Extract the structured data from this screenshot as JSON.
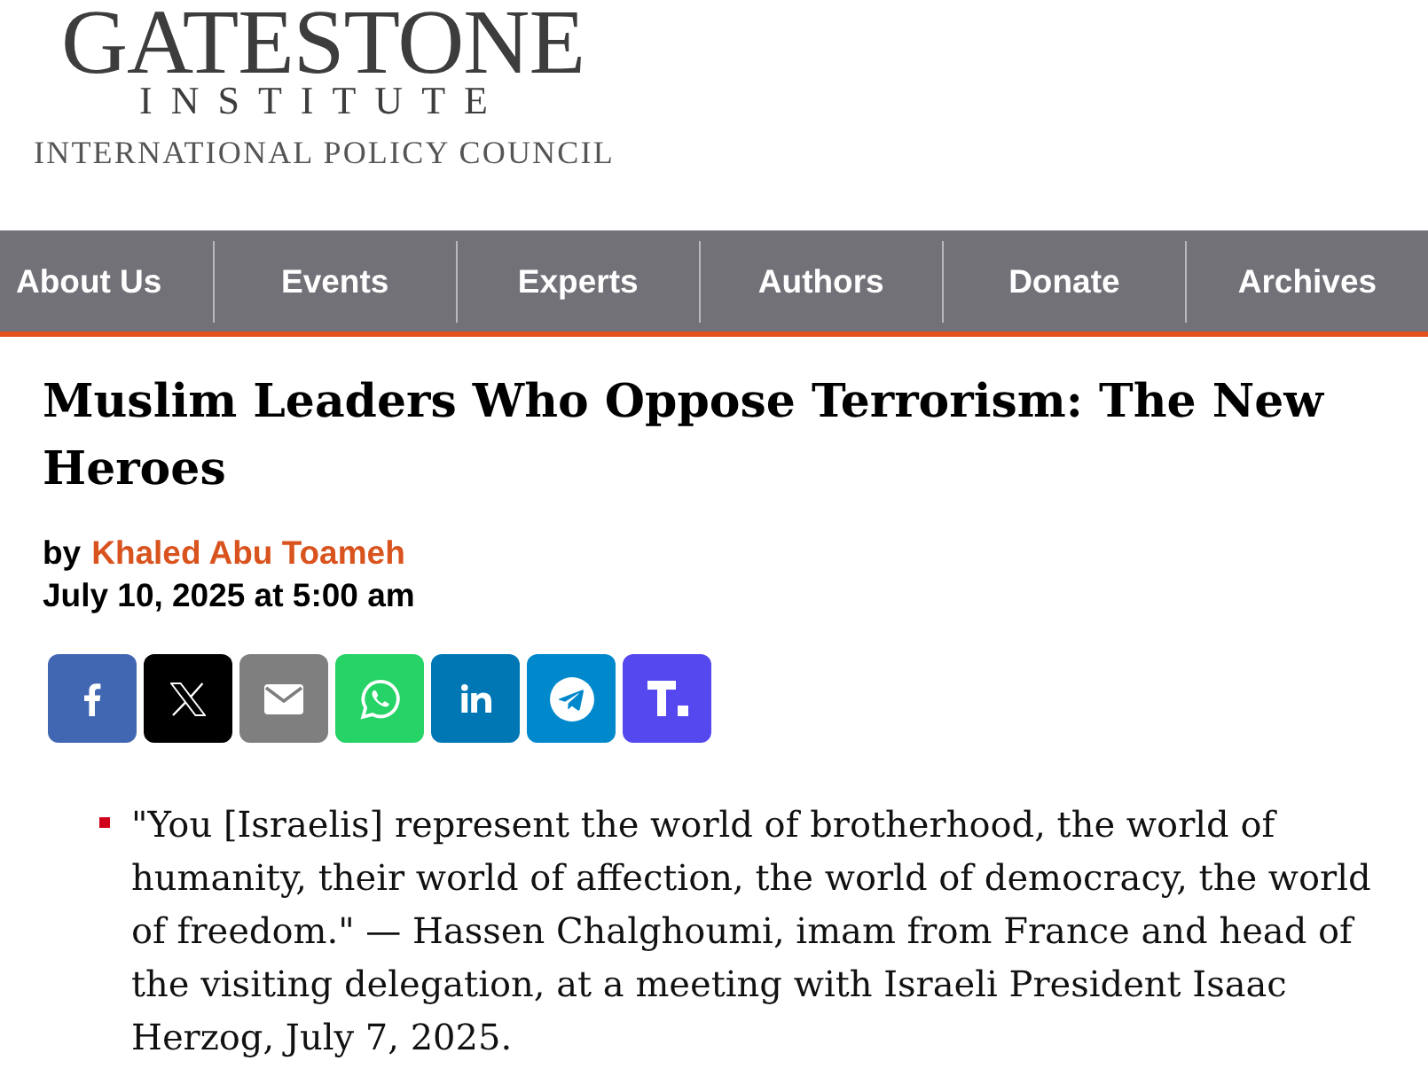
{
  "logo": {
    "wordmark": "GATESTONE",
    "subtitle": "INSTITUTE",
    "tagline": "INTERNATIONAL POLICY COUNCIL"
  },
  "nav": [
    {
      "label": "About Us"
    },
    {
      "label": "Events"
    },
    {
      "label": "Experts"
    },
    {
      "label": "Authors"
    },
    {
      "label": "Donate"
    },
    {
      "label": "Archives"
    }
  ],
  "article": {
    "title": "Muslim Leaders Who Oppose Terrorism: The New Heroes",
    "byline_prefix": "by",
    "author": "Khaled Abu Toameh",
    "date": "July 10, 2025 at 5:00 am"
  },
  "share_buttons": [
    {
      "kind": "facebook",
      "color": "#4267b2"
    },
    {
      "kind": "x",
      "color": "#000000"
    },
    {
      "kind": "email",
      "color": "#7f7f7f"
    },
    {
      "kind": "whatsapp",
      "color": "#25d366"
    },
    {
      "kind": "linkedin",
      "color": "#0077b5"
    },
    {
      "kind": "telegram",
      "color": "#0088cc"
    },
    {
      "kind": "truth",
      "color": "#5448ee"
    }
  ],
  "bullets": [
    "\"You [Israelis] represent the world of brotherhood, the world of humanity, their world of affection, the world of democracy, the world of freedom.\" — Hassen Chalghoumi, imam from France and head of the visiting delegation, at a meeting with Israeli President Isaac Herzog, July 7, 2025."
  ]
}
